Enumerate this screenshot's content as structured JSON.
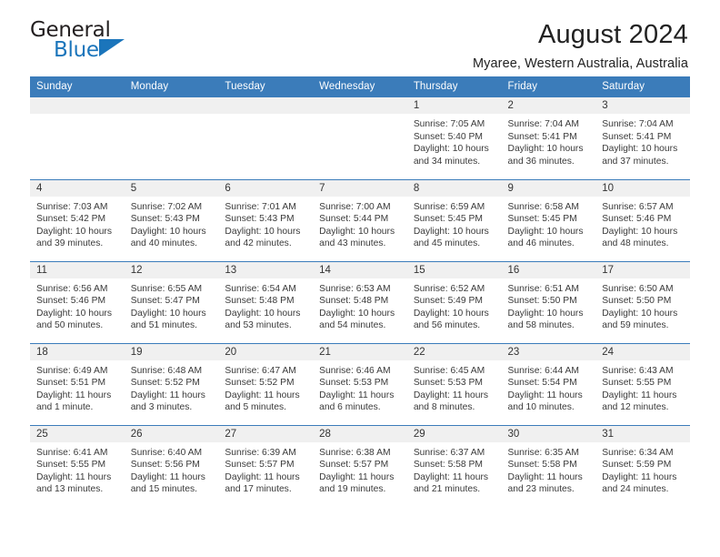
{
  "brand": {
    "name_top": "General",
    "name_bottom": "Blue",
    "triangle_icon": "blue-triangle-icon",
    "color_dark": "#231f20",
    "color_blue": "#1b75bb"
  },
  "header": {
    "title": "August 2024",
    "subtitle": "Myaree, Western Australia, Australia"
  },
  "theme": {
    "header_bg": "#3b7cba",
    "header_text": "#ffffff",
    "daynum_bg": "#f0f0f0",
    "cell_bg": "#ffffff",
    "grid_line": "#3b7cba"
  },
  "weekdays": [
    "Sunday",
    "Monday",
    "Tuesday",
    "Wednesday",
    "Thursday",
    "Friday",
    "Saturday"
  ],
  "weeks": [
    [
      {
        "day": "",
        "sunrise": "",
        "sunset": "",
        "daylight": "",
        "empty": true
      },
      {
        "day": "",
        "sunrise": "",
        "sunset": "",
        "daylight": "",
        "empty": true
      },
      {
        "day": "",
        "sunrise": "",
        "sunset": "",
        "daylight": "",
        "empty": true
      },
      {
        "day": "",
        "sunrise": "",
        "sunset": "",
        "daylight": "",
        "empty": true
      },
      {
        "day": "1",
        "sunrise": "Sunrise: 7:05 AM",
        "sunset": "Sunset: 5:40 PM",
        "daylight": "Daylight: 10 hours and 34 minutes."
      },
      {
        "day": "2",
        "sunrise": "Sunrise: 7:04 AM",
        "sunset": "Sunset: 5:41 PM",
        "daylight": "Daylight: 10 hours and 36 minutes."
      },
      {
        "day": "3",
        "sunrise": "Sunrise: 7:04 AM",
        "sunset": "Sunset: 5:41 PM",
        "daylight": "Daylight: 10 hours and 37 minutes."
      }
    ],
    [
      {
        "day": "4",
        "sunrise": "Sunrise: 7:03 AM",
        "sunset": "Sunset: 5:42 PM",
        "daylight": "Daylight: 10 hours and 39 minutes."
      },
      {
        "day": "5",
        "sunrise": "Sunrise: 7:02 AM",
        "sunset": "Sunset: 5:43 PM",
        "daylight": "Daylight: 10 hours and 40 minutes."
      },
      {
        "day": "6",
        "sunrise": "Sunrise: 7:01 AM",
        "sunset": "Sunset: 5:43 PM",
        "daylight": "Daylight: 10 hours and 42 minutes."
      },
      {
        "day": "7",
        "sunrise": "Sunrise: 7:00 AM",
        "sunset": "Sunset: 5:44 PM",
        "daylight": "Daylight: 10 hours and 43 minutes."
      },
      {
        "day": "8",
        "sunrise": "Sunrise: 6:59 AM",
        "sunset": "Sunset: 5:45 PM",
        "daylight": "Daylight: 10 hours and 45 minutes."
      },
      {
        "day": "9",
        "sunrise": "Sunrise: 6:58 AM",
        "sunset": "Sunset: 5:45 PM",
        "daylight": "Daylight: 10 hours and 46 minutes."
      },
      {
        "day": "10",
        "sunrise": "Sunrise: 6:57 AM",
        "sunset": "Sunset: 5:46 PM",
        "daylight": "Daylight: 10 hours and 48 minutes."
      }
    ],
    [
      {
        "day": "11",
        "sunrise": "Sunrise: 6:56 AM",
        "sunset": "Sunset: 5:46 PM",
        "daylight": "Daylight: 10 hours and 50 minutes."
      },
      {
        "day": "12",
        "sunrise": "Sunrise: 6:55 AM",
        "sunset": "Sunset: 5:47 PM",
        "daylight": "Daylight: 10 hours and 51 minutes."
      },
      {
        "day": "13",
        "sunrise": "Sunrise: 6:54 AM",
        "sunset": "Sunset: 5:48 PM",
        "daylight": "Daylight: 10 hours and 53 minutes."
      },
      {
        "day": "14",
        "sunrise": "Sunrise: 6:53 AM",
        "sunset": "Sunset: 5:48 PM",
        "daylight": "Daylight: 10 hours and 54 minutes."
      },
      {
        "day": "15",
        "sunrise": "Sunrise: 6:52 AM",
        "sunset": "Sunset: 5:49 PM",
        "daylight": "Daylight: 10 hours and 56 minutes."
      },
      {
        "day": "16",
        "sunrise": "Sunrise: 6:51 AM",
        "sunset": "Sunset: 5:50 PM",
        "daylight": "Daylight: 10 hours and 58 minutes."
      },
      {
        "day": "17",
        "sunrise": "Sunrise: 6:50 AM",
        "sunset": "Sunset: 5:50 PM",
        "daylight": "Daylight: 10 hours and 59 minutes."
      }
    ],
    [
      {
        "day": "18",
        "sunrise": "Sunrise: 6:49 AM",
        "sunset": "Sunset: 5:51 PM",
        "daylight": "Daylight: 11 hours and 1 minute."
      },
      {
        "day": "19",
        "sunrise": "Sunrise: 6:48 AM",
        "sunset": "Sunset: 5:52 PM",
        "daylight": "Daylight: 11 hours and 3 minutes."
      },
      {
        "day": "20",
        "sunrise": "Sunrise: 6:47 AM",
        "sunset": "Sunset: 5:52 PM",
        "daylight": "Daylight: 11 hours and 5 minutes."
      },
      {
        "day": "21",
        "sunrise": "Sunrise: 6:46 AM",
        "sunset": "Sunset: 5:53 PM",
        "daylight": "Daylight: 11 hours and 6 minutes."
      },
      {
        "day": "22",
        "sunrise": "Sunrise: 6:45 AM",
        "sunset": "Sunset: 5:53 PM",
        "daylight": "Daylight: 11 hours and 8 minutes."
      },
      {
        "day": "23",
        "sunrise": "Sunrise: 6:44 AM",
        "sunset": "Sunset: 5:54 PM",
        "daylight": "Daylight: 11 hours and 10 minutes."
      },
      {
        "day": "24",
        "sunrise": "Sunrise: 6:43 AM",
        "sunset": "Sunset: 5:55 PM",
        "daylight": "Daylight: 11 hours and 12 minutes."
      }
    ],
    [
      {
        "day": "25",
        "sunrise": "Sunrise: 6:41 AM",
        "sunset": "Sunset: 5:55 PM",
        "daylight": "Daylight: 11 hours and 13 minutes."
      },
      {
        "day": "26",
        "sunrise": "Sunrise: 6:40 AM",
        "sunset": "Sunset: 5:56 PM",
        "daylight": "Daylight: 11 hours and 15 minutes."
      },
      {
        "day": "27",
        "sunrise": "Sunrise: 6:39 AM",
        "sunset": "Sunset: 5:57 PM",
        "daylight": "Daylight: 11 hours and 17 minutes."
      },
      {
        "day": "28",
        "sunrise": "Sunrise: 6:38 AM",
        "sunset": "Sunset: 5:57 PM",
        "daylight": "Daylight: 11 hours and 19 minutes."
      },
      {
        "day": "29",
        "sunrise": "Sunrise: 6:37 AM",
        "sunset": "Sunset: 5:58 PM",
        "daylight": "Daylight: 11 hours and 21 minutes."
      },
      {
        "day": "30",
        "sunrise": "Sunrise: 6:35 AM",
        "sunset": "Sunset: 5:58 PM",
        "daylight": "Daylight: 11 hours and 23 minutes."
      },
      {
        "day": "31",
        "sunrise": "Sunrise: 6:34 AM",
        "sunset": "Sunset: 5:59 PM",
        "daylight": "Daylight: 11 hours and 24 minutes."
      }
    ]
  ]
}
